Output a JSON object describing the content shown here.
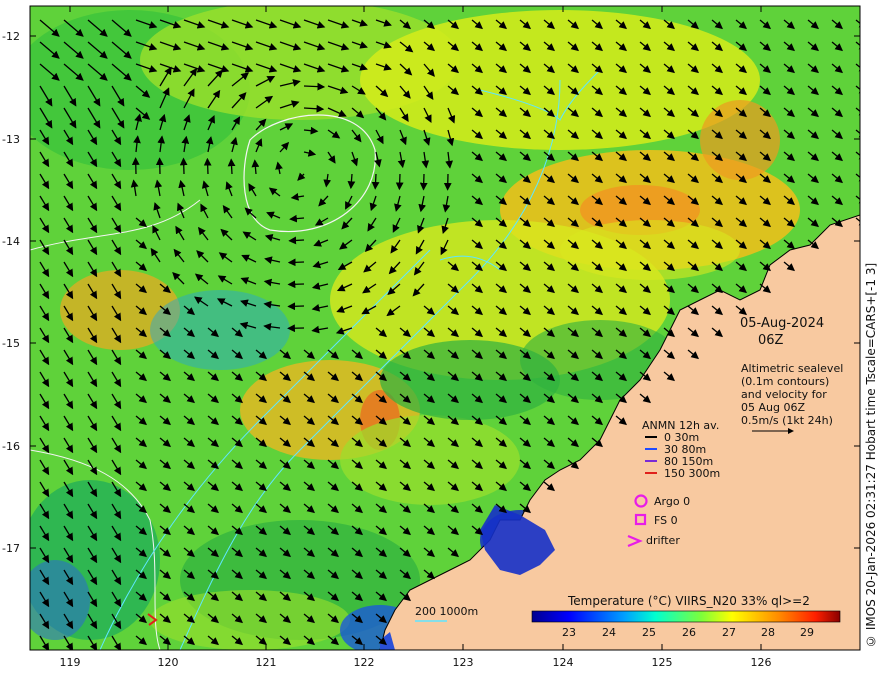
{
  "map": {
    "date": "05-Aug-2024",
    "time": "06Z",
    "lat_ticks": [
      "-12",
      "-13",
      "-14",
      "-15",
      "-16",
      "-17"
    ],
    "lon_ticks": [
      "119",
      "120",
      "121",
      "122",
      "123",
      "124",
      "125",
      "126"
    ],
    "altimetry_lines": [
      "Altimetric sealevel",
      "(0.1m contours)",
      "and velocity for",
      "05 Aug 06Z",
      "0.5m/s (1kt 24h)"
    ],
    "anmn_title": "ANMN 12h av.",
    "anmn_items": [
      {
        "label": "0 30m",
        "color": "#000000"
      },
      {
        "label": "30 80m",
        "color": "#1f4bff"
      },
      {
        "label": "80 150m",
        "color": "#7a2bd6"
      },
      {
        "label": "150 300m",
        "color": "#e0201b"
      }
    ],
    "argo_label": "Argo 0",
    "fs_label": "FS 0",
    "drifter_label": "drifter",
    "marker_color": "#e81ce8",
    "bathy_label": "200  1000m",
    "colorbar_title": "Temperature (°C) VIIRS_N20 33% ql>=2",
    "colorbar_ticks": [
      "23",
      "24",
      "25",
      "26",
      "27",
      "28",
      "29"
    ],
    "credit": "© IMOS 20-Jan-2026 02:31:27 Hobart time Tscale=CARS+[-1 3]",
    "land_color": "#f8c9a0"
  }
}
